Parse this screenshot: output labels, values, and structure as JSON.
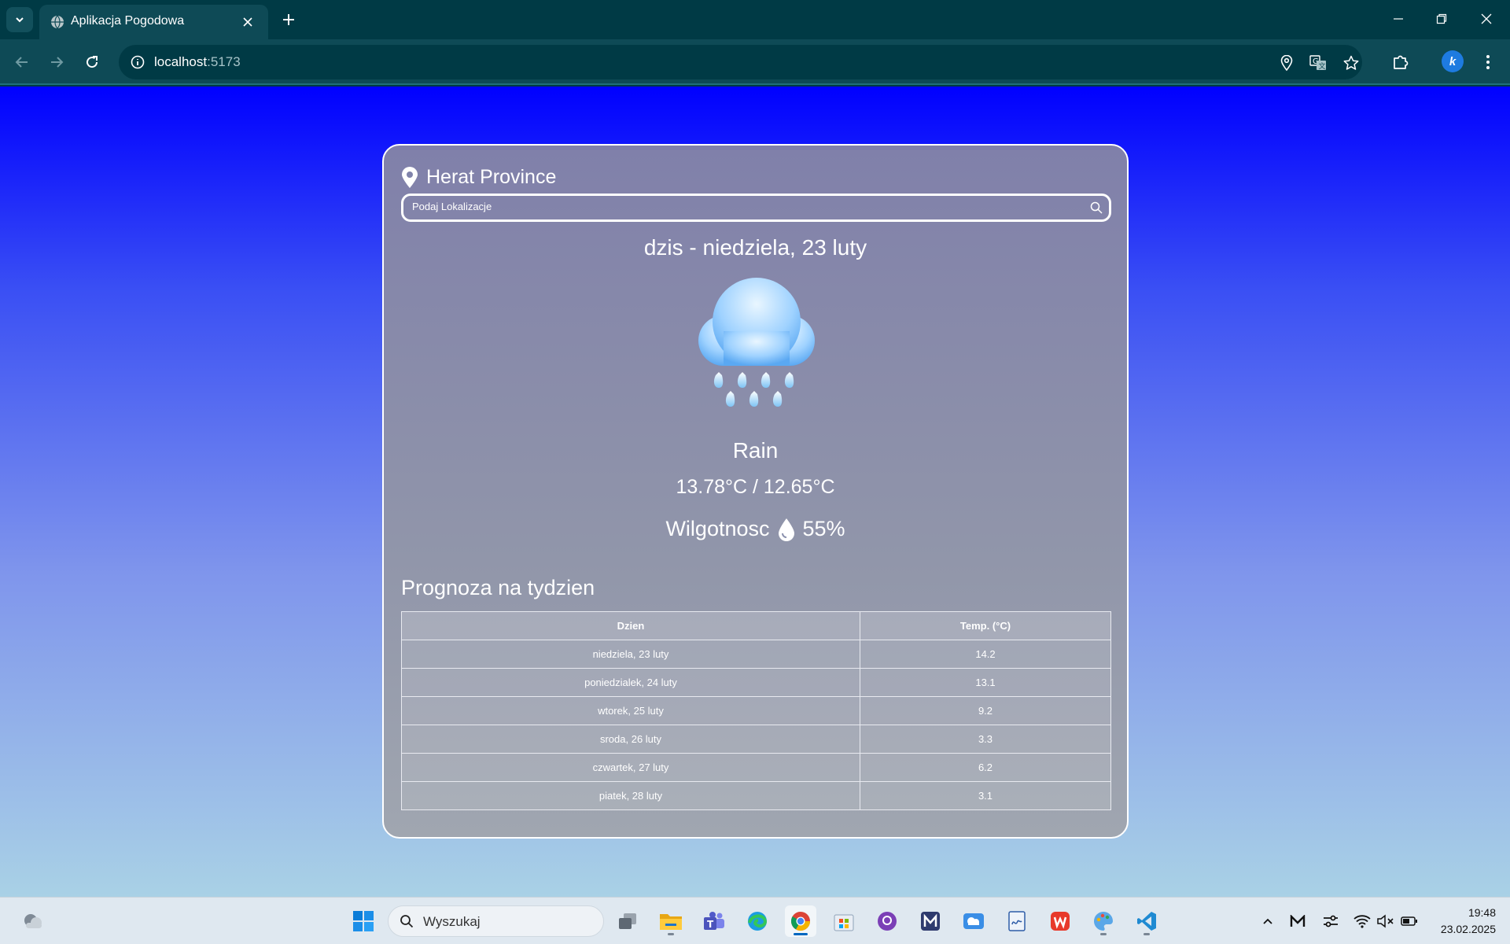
{
  "browser": {
    "tab_title": "Aplikacja Pogodowa",
    "url_host": "localhost",
    "url_port": ":5173",
    "profile_letter": "k"
  },
  "app": {
    "location": "Herat Province",
    "search_placeholder": "Podaj Lokalizacje",
    "date_label": "dzis - niedziela, 23 luty",
    "condition": "Rain",
    "temperatures": "13.78°C / 12.65°C",
    "humidity_label": "Wilgotnosc",
    "humidity_value": "55%",
    "forecast_title": "Prognoza na tydzien",
    "forecast_headers": [
      "Dzien",
      "Temp. (°C)"
    ],
    "forecast_rows": [
      {
        "day": "niedziela, 23 luty",
        "temp": "14.2"
      },
      {
        "day": "poniedzialek, 24 luty",
        "temp": "13.1"
      },
      {
        "day": "wtorek, 25 luty",
        "temp": "9.2"
      },
      {
        "day": "sroda, 26 luty",
        "temp": "3.3"
      },
      {
        "day": "czwartek, 27 luty",
        "temp": "6.2"
      },
      {
        "day": "piatek, 28 luty",
        "temp": "3.1"
      }
    ]
  },
  "taskbar": {
    "search_label": "Wyszukaj",
    "time": "19:48",
    "date": "23.02.2025"
  },
  "colors": {
    "page_gradient_top": "#0000ff",
    "page_gradient_bottom": "#a9d1e6",
    "chrome_dark": "#003a45",
    "chrome_toolbar": "#0e4a56"
  }
}
